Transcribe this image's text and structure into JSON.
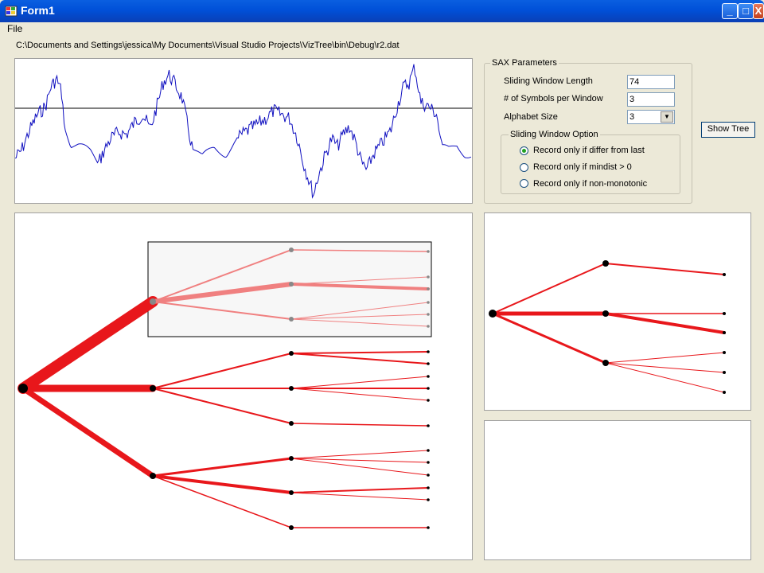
{
  "window": {
    "title": "Form1",
    "minimize": "_",
    "maximize": "□",
    "close": "X"
  },
  "menu": {
    "file": "File"
  },
  "file_path": "C:\\Documents and Settings\\jessica\\My Documents\\Visual Studio Projects\\VizTree\\bin\\Debug\\r2.dat",
  "sax": {
    "title": "SAX Parameters",
    "window_length_label": "Sliding Window Length",
    "window_length_value": "74",
    "symbols_label": "# of Symbols per Window",
    "symbols_value": "3",
    "alphabet_label": "Alphabet Size",
    "alphabet_value": "3",
    "option_title": "Sliding Window Option",
    "options": [
      "Record only if differ from last",
      "Record only if mindist > 0",
      "Record only if non-monotonic"
    ],
    "selected_option": 0
  },
  "buttons": {
    "show_tree": "Show Tree"
  },
  "colors": {
    "titlebar": "#0050d8",
    "tree": "#e8171b",
    "series": "#1010c0"
  }
}
